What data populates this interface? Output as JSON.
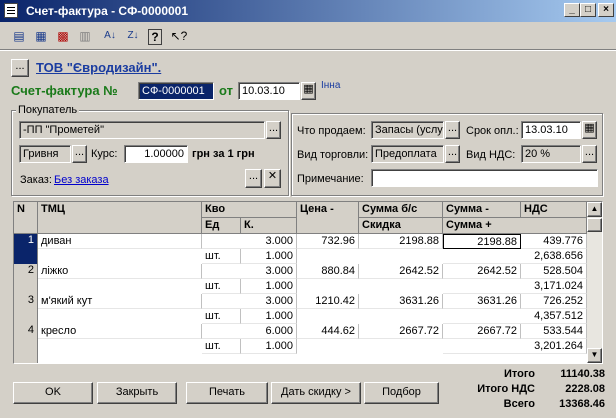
{
  "window": {
    "title": "Счет-фактура - СФ-0000001",
    "minimize": "_",
    "maximize": "□",
    "close": "×"
  },
  "toolbar": {
    "icons": [
      "doc-new-icon",
      "doc-edit-icon",
      "doc-delete-icon",
      "doc-copy-icon",
      "sort-az-icon",
      "sort-za-icon",
      "help-icon",
      "context-help-icon"
    ]
  },
  "header": {
    "org_button": "...",
    "org_name": "ТОВ \"Євродизайн\".",
    "doc_label": "Счет-фактура №",
    "doc_number": "СФ-0000001",
    "date_label": "от",
    "date": "10.03.10",
    "user": "Інна"
  },
  "buyer": {
    "group_label": "Покупатель",
    "name": "-ПП \"Прометей\"",
    "currency": "Гривня",
    "rate_label": "Курс:",
    "rate": "1.00000",
    "rate_unit": "грн за 1 грн",
    "order_label": "Заказ:",
    "order_link": "Без заказа"
  },
  "options": {
    "sell_label": "Что продаем:",
    "sell_value": "Запасы (услу",
    "term_label": "Срок опл.:",
    "term_value": "13.03.10",
    "trade_label": "Вид торговли:",
    "trade_value": "Предоплата",
    "vat_label": "Вид НДС:",
    "vat_value": "20 %",
    "note_label": "Примечание:",
    "note_value": ""
  },
  "table": {
    "headers": {
      "n": "N",
      "item": "ТМЦ",
      "qty": "Кво",
      "unit": "Ед",
      "k": "К.",
      "price": "Цена -",
      "sum": "Сумма б/с",
      "discount": "Скидка",
      "sum2": "Сумма -",
      "vat": "НДС",
      "sum_plus": "Сумма +"
    },
    "rows": [
      {
        "n": "1",
        "item": "диван",
        "unit": "шт.",
        "qty": "3.000",
        "k": "1.000",
        "price": "732.96",
        "sum": "2198.88",
        "sum2": "2198.88",
        "vat": "439.776",
        "total": "2,638.656"
      },
      {
        "n": "2",
        "item": "ліжко",
        "unit": "шт.",
        "qty": "3.000",
        "k": "1.000",
        "price": "880.84",
        "sum": "2642.52",
        "sum2": "2642.52",
        "vat": "528.504",
        "total": "3,171.024"
      },
      {
        "n": "3",
        "item": "м'який кут",
        "unit": "шт.",
        "qty": "3.000",
        "k": "1.000",
        "price": "1210.42",
        "sum": "3631.26",
        "sum2": "3631.26",
        "vat": "726.252",
        "total": "4,357.512"
      },
      {
        "n": "4",
        "item": "кресло",
        "unit": "шт.",
        "qty": "6.000",
        "k": "1.000",
        "price": "444.62",
        "sum": "2667.72",
        "sum2": "2667.72",
        "vat": "533.544",
        "total": "3,201.264"
      }
    ]
  },
  "buttons": {
    "ok": "OK",
    "close": "Закрыть",
    "print": "Печать",
    "discount": "Дать скидку >",
    "select": "Подбор"
  },
  "totals": {
    "total_label": "Итого",
    "total_value": "11140.38",
    "vat_label": "Итого НДС",
    "vat_value": "2228.08",
    "grand_label": "Всего",
    "grand_value": "13368.46"
  }
}
